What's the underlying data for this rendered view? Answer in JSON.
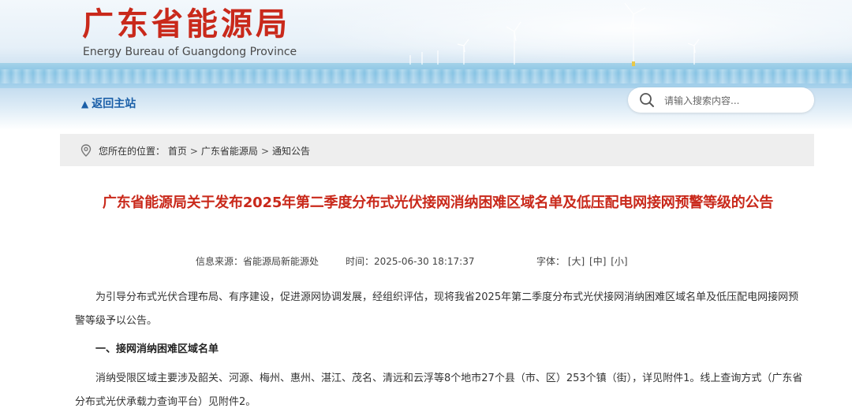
{
  "header": {
    "logo_cn": "广东省能源局",
    "logo_en": "Energy Bureau of Guangdong Province",
    "back_label": "返回主站",
    "search_placeholder": "请输入搜索内容..."
  },
  "breadcrumb": {
    "prefix": "您所在的位置：",
    "items": [
      "首页",
      "广东省能源局",
      "通知公告"
    ],
    "separator": ">"
  },
  "article": {
    "title": "广东省能源局关于发布2025年第二季度分布式光伏接网消纳困难区域名单及低压配电网接网预警等级的公告",
    "source_label": "信息来源：",
    "source": "省能源局新能源处",
    "time_label": "时间：",
    "time": "2025-06-30 18:17:37",
    "font_label": "字体：",
    "font_sizes": [
      "[大]",
      "[中]",
      "[小]"
    ],
    "paragraph1": "为引导分布式光伏合理布局、有序建设，促进源网协调发展，经组织评估，现将我省2025年第二季度分布式光伏接网消纳困难区域名单及低压配电网接网预警等级予以公告。",
    "section1_heading": "一、接网消纳困难区域名单",
    "paragraph2": "消纳受限区域主要涉及韶关、河源、梅州、惠州、湛江、茂名、清远和云浮等8个地市27个县（市、区）253个镇（街），详见附件1。线上查询方式（广东省分布式光伏承载力查询平台）见附件2。"
  },
  "colors": {
    "accent_red": "#c9291b",
    "link_blue": "#1a5fa8",
    "breadcrumb_bg": "#eeeeee"
  },
  "icons": {
    "search": "search-icon",
    "location": "location-pin-icon",
    "back": "arrow-up-icon"
  }
}
